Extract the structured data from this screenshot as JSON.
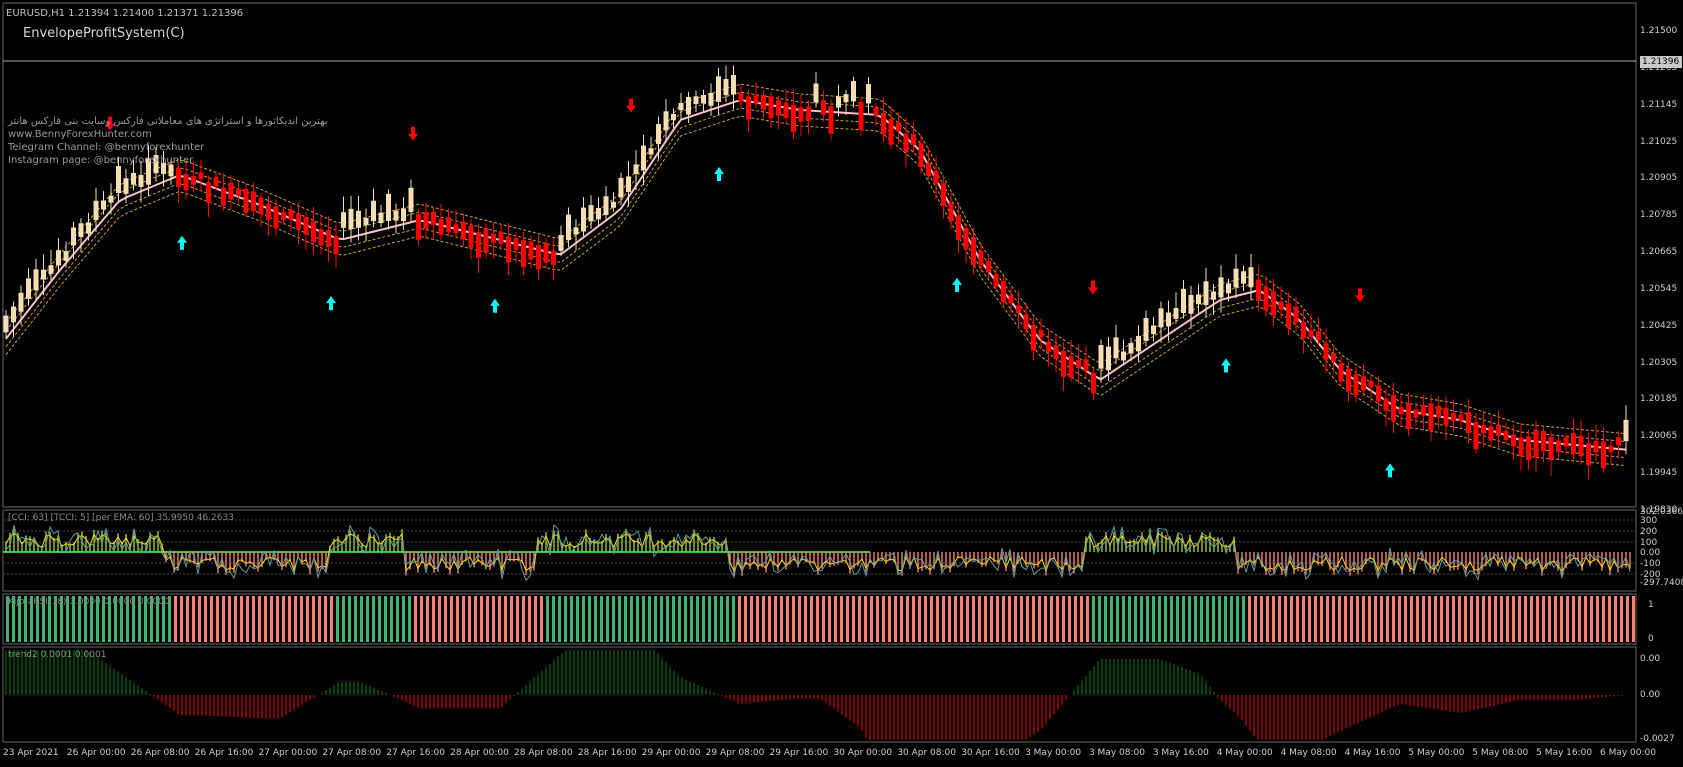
{
  "window": {
    "symbol_line": "EURUSD,H1  1.21394 1.21400 1.21371 1.21396",
    "system_name": "EnvelopeProfitSystem(C)",
    "promo_lines": [
      "بهترین اندیکاتورها و استراتژی های معاملاتی فارکس وسایت بنی فارکس هانتر",
      "www.BennyForexHunter.com",
      "Telegram Channel: @bennyforexhunter",
      "Instagram page: @bennyforexhunter"
    ],
    "current_price": "1.21396"
  },
  "price_axis": [
    "1.21500",
    "1.21265",
    "1.21145",
    "1.21025",
    "1.20905",
    "1.20785",
    "1.20665",
    "1.20545",
    "1.20425",
    "1.20305",
    "1.20185",
    "1.20065",
    "1.19945",
    "1.19830"
  ],
  "time_axis": [
    "23 Apr 2021",
    "26 Apr 00:00",
    "26 Apr 08:00",
    "26 Apr 16:00",
    "27 Apr 00:00",
    "27 Apr 08:00",
    "27 Apr 16:00",
    "28 Apr 00:00",
    "28 Apr 08:00",
    "28 Apr 16:00",
    "29 Apr 00:00",
    "29 Apr 08:00",
    "29 Apr 16:00",
    "30 Apr 00:00",
    "30 Apr 08:00",
    "30 Apr 16:00",
    "3 May 00:00",
    "3 May 08:00",
    "3 May 16:00",
    "4 May 00:00",
    "4 May 08:00",
    "4 May 16:00",
    "5 May 00:00",
    "5 May 08:00",
    "5 May 16:00",
    "6 May 00:00"
  ],
  "cci_panel": {
    "title": "[CCI: 63] [TCCI: 5] [per EMA: 60]  35.9950 46.2633",
    "axis": [
      "302.0366",
      "300",
      "200",
      "100",
      "0.00",
      "-100",
      "-200",
      "-297.7408"
    ]
  },
  "rsi_panel": {
    "title": "Kijo-aRSI(18)  1.0000 0.0000 0.0000",
    "axis": [
      "1",
      "0"
    ]
  },
  "trend_panel": {
    "title": "trend2 0.0001 0.0001",
    "axis": [
      "0.00",
      "0.00",
      "-0.0027"
    ]
  },
  "colors": {
    "bull": "#f5deb3",
    "bear": "#ff0000",
    "ema": "#ffc0cb",
    "envelope": "#d4a017",
    "arrow_up": "#00ffff",
    "arrow_down": "#ff0000",
    "rsi_bull": "#3cb371",
    "rsi_bear": "#fa8072",
    "trend_bull": "#008000",
    "trend_bear": "#ff0000"
  }
}
